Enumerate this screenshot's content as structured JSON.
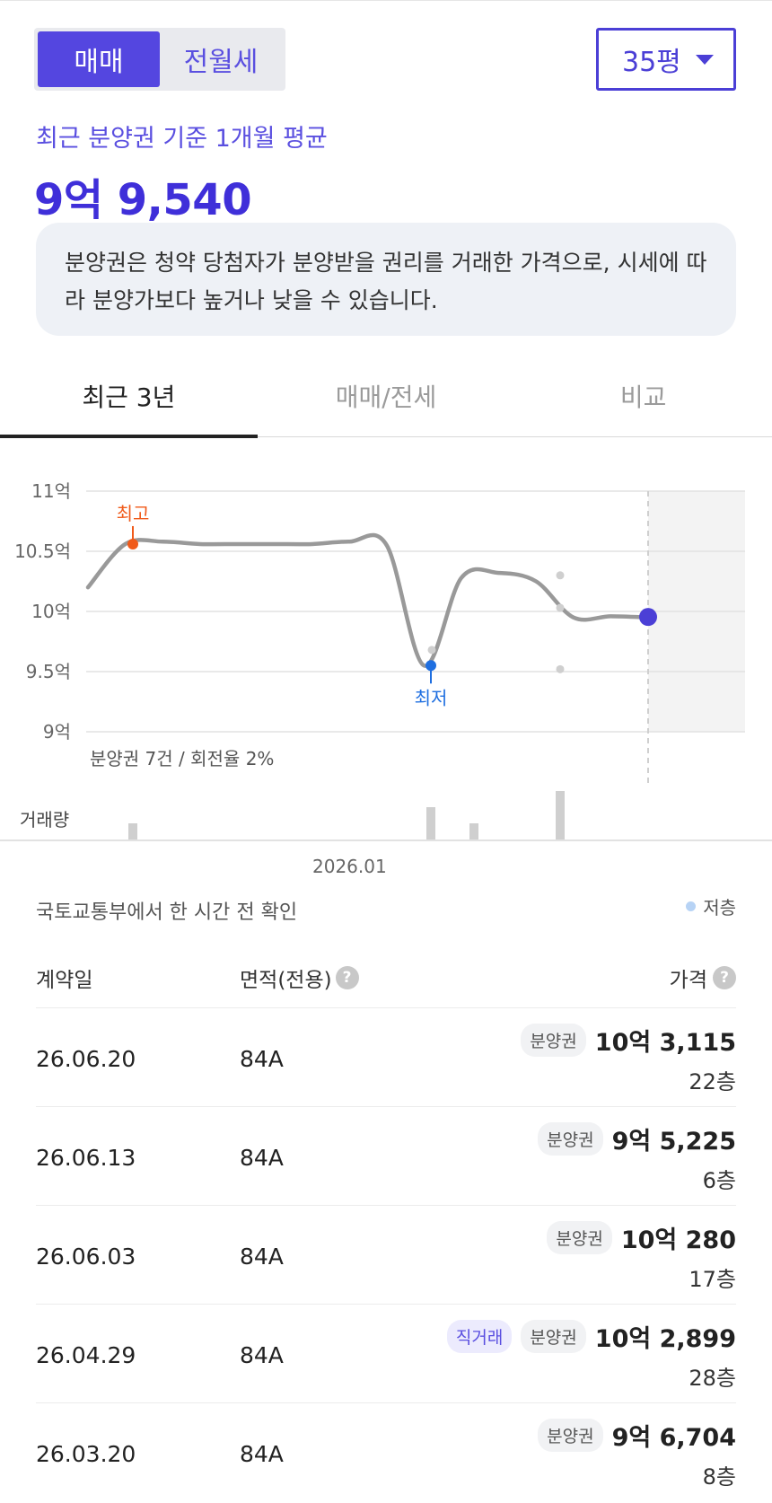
{
  "trade_toggle": {
    "options": [
      "매매",
      "전월세"
    ],
    "selected": "매매"
  },
  "area_select": {
    "value": "35평"
  },
  "average": {
    "label": "최근 분양권 기준 1개월 평균",
    "price": "9억 9,540"
  },
  "notice": "분양권은 청약 당첨자가 분양받을 권리를 거래한 가격으로, 시세에 따라 분양가보다 높거나 낮을 수 있습니다.",
  "tabs": [
    {
      "label": "최근 3년",
      "active": true
    },
    {
      "label": "매매/전세",
      "active": false
    },
    {
      "label": "비교",
      "active": false
    }
  ],
  "chart_data": {
    "type": "line",
    "y_ticks": [
      "11억",
      "10.5억",
      "10억",
      "9.5억",
      "9억"
    ],
    "ylim": [
      9,
      11
    ],
    "x_ticks": [
      "2026.01"
    ],
    "series": [
      {
        "values": [
          10.2,
          10.56,
          10.58,
          10.56,
          10.56,
          10.56,
          10.56,
          10.58,
          10.55,
          9.55,
          10.28,
          10.32,
          10.25,
          9.95,
          9.96,
          9.95
        ]
      }
    ],
    "markers": {
      "high": {
        "label": "최고",
        "value": 10.56
      },
      "low": {
        "label": "최저",
        "value": 9.55
      },
      "current": 9.954
    },
    "points": [
      10.3,
      10.03,
      9.52,
      9.68
    ],
    "note": "분양권 7건 / 회전율 2%",
    "volume_label": "거래량",
    "volume": [
      1,
      2,
      1,
      3
    ]
  },
  "source_note": "국토교통부에서 한 시간 전 확인",
  "legend": {
    "label": "저층",
    "color": "#b7d3f5"
  },
  "table": {
    "headers": {
      "date": "계약일",
      "area": "면적(전용)",
      "price": "가격"
    },
    "rows": [
      {
        "date": "26.06.20",
        "area": "84A",
        "badges": [
          "분양권"
        ],
        "price": "10억 3,115",
        "floor": "22층"
      },
      {
        "date": "26.06.13",
        "area": "84A",
        "badges": [
          "분양권"
        ],
        "price": "9억 5,225",
        "floor": "6층"
      },
      {
        "date": "26.06.03",
        "area": "84A",
        "badges": [
          "분양권"
        ],
        "price": "10억 280",
        "floor": "17층"
      },
      {
        "date": "26.04.29",
        "area": "84A",
        "badges": [
          "직거래",
          "분양권"
        ],
        "price": "10억 2,899",
        "floor": "28층"
      },
      {
        "date": "26.03.20",
        "area": "84A",
        "badges": [
          "분양권"
        ],
        "price": "9억 6,704",
        "floor": "8층"
      }
    ]
  },
  "colors": {
    "accent": "#4b3fd6",
    "high": "#f05a1a",
    "low": "#1f6fe0",
    "line": "#999999"
  }
}
